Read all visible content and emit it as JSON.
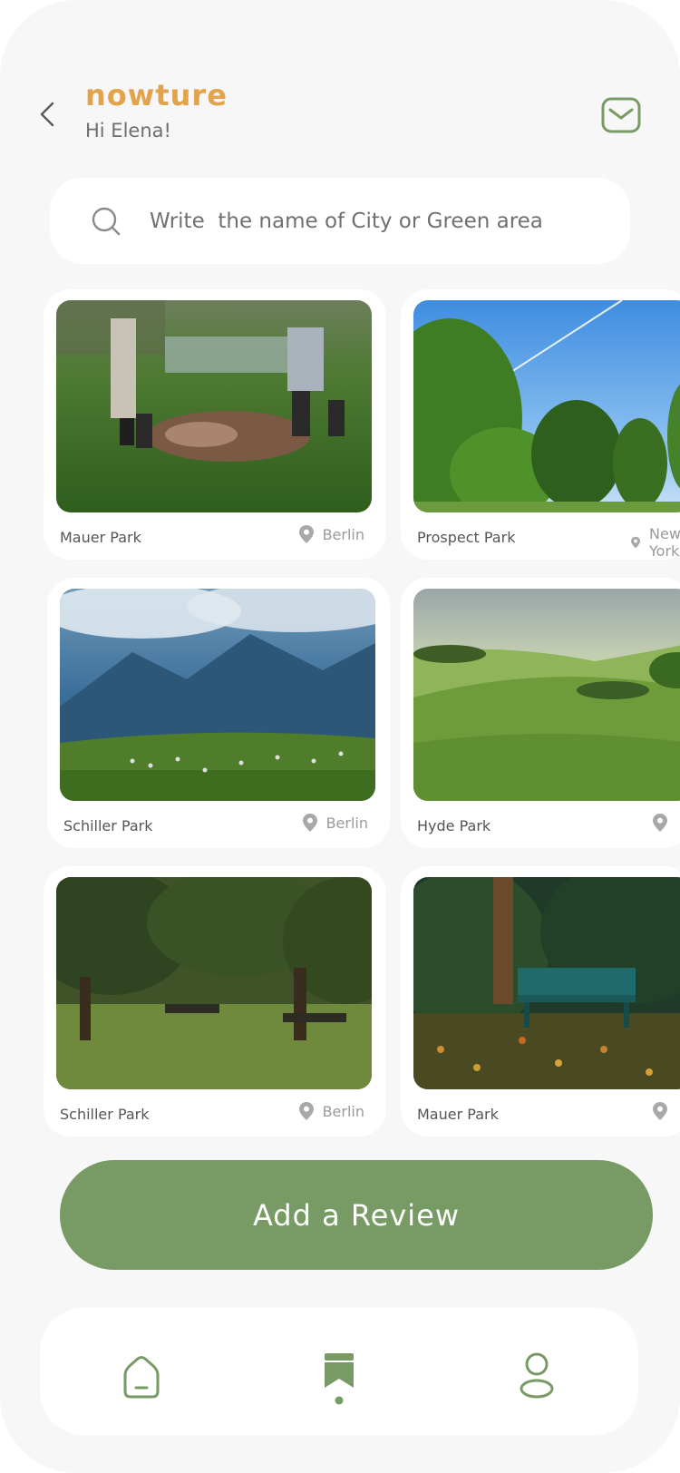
{
  "header": {
    "logo": "nowture",
    "greeting": "Hi Elena!"
  },
  "search": {
    "placeholder": "Write  the name of City or Green area",
    "value": ""
  },
  "parks": [
    {
      "name": "Mauer Park",
      "city": "Berlin"
    },
    {
      "name": "Prospect Park",
      "city": "New York"
    },
    {
      "name": "Schiller Park",
      "city": "Berlin"
    },
    {
      "name": "Hyde Park",
      "city": ""
    },
    {
      "name": "Schiller Park",
      "city": "Berlin"
    },
    {
      "name": "Mauer Park",
      "city": ""
    }
  ],
  "review_button": {
    "label": "Add a Review"
  },
  "nav": {
    "items": [
      "home-icon",
      "bookmark-icon",
      "user-icon"
    ],
    "active": "bookmark-icon"
  },
  "colors": {
    "brand": "#e2a34a",
    "accent": "#789a64",
    "background": "#f7f7f7",
    "card": "#ffffff"
  }
}
